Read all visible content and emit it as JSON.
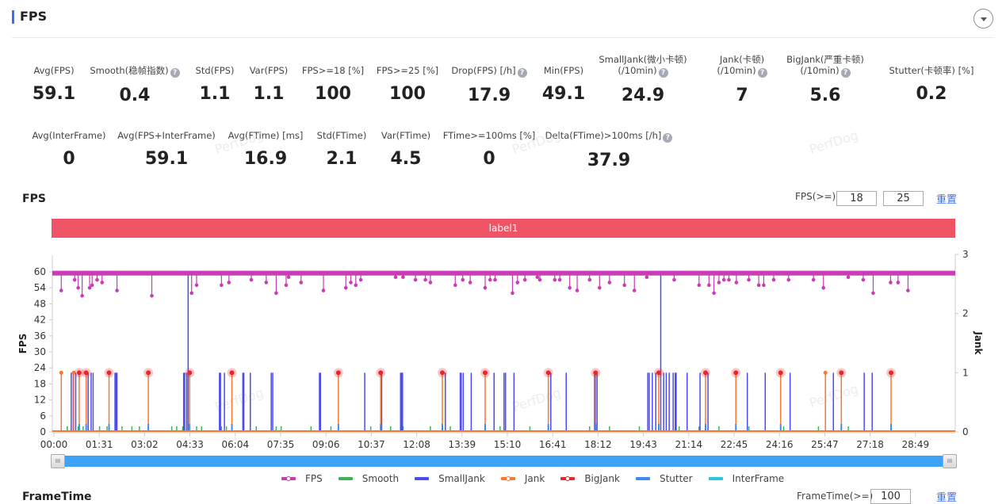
{
  "header": {
    "title": "FPS",
    "toggle_icon": "caret-down-icon"
  },
  "metrics_row1": [
    {
      "label": "Avg(FPS)",
      "value": "59.1",
      "help": false
    },
    {
      "label": "Smooth(稳帧指数)",
      "value": "0.4",
      "help": true
    },
    {
      "label": "Std(FPS)",
      "value": "1.1",
      "help": false
    },
    {
      "label": "Var(FPS)",
      "value": "1.1",
      "help": false
    },
    {
      "label": "FPS>=18 [%]",
      "value": "100",
      "help": false
    },
    {
      "label": "FPS>=25 [%]",
      "value": "100",
      "help": false
    },
    {
      "label": "Drop(FPS) [/h]",
      "value": "17.9",
      "help": true
    },
    {
      "label": "Min(FPS)",
      "value": "49.1",
      "help": false
    },
    {
      "label": "SmallJank(微小卡顿)",
      "label2": "(/10min)",
      "value": "24.9",
      "help": true
    },
    {
      "label": "Jank(卡顿)",
      "label2": "(/10min)",
      "value": "7",
      "help": true
    },
    {
      "label": "BigJank(严重卡顿)",
      "label2": "(/10min)",
      "value": "5.6",
      "help": true
    },
    {
      "label": "Stutter(卡顿率) [%]",
      "value": "0.2",
      "help": false
    }
  ],
  "metrics_row2": [
    {
      "label": "Avg(InterFrame)",
      "value": "0",
      "help": false
    },
    {
      "label": "Avg(FPS+InterFrame)",
      "value": "59.1",
      "help": false
    },
    {
      "label": "Avg(FTime) [ms]",
      "value": "16.9",
      "help": false
    },
    {
      "label": "Std(FTime)",
      "value": "2.1",
      "help": false
    },
    {
      "label": "Var(FTime)",
      "value": "4.5",
      "help": false
    },
    {
      "label": "FTime>=100ms [%]",
      "value": "0",
      "help": false
    },
    {
      "label": "Delta(FTime)>100ms [/h]",
      "value": "37.9",
      "help": true
    }
  ],
  "help_glyph": "?",
  "watermark": "PerfDog",
  "chart_section": {
    "title": "FPS",
    "filter_label": "FPS(>=)",
    "filter_values": [
      "18",
      "25"
    ],
    "reset_label": "重置",
    "label_bar": "label1",
    "slider_handle_glyph": "III"
  },
  "next_section": {
    "title": "FrameTime",
    "filter_label": "FrameTime(>=)",
    "filter_value": "100",
    "reset_label": "重置"
  },
  "colors": {
    "fps": "#c83cb4",
    "smooth": "#3cb45a",
    "smalljank": "#4b4bf0",
    "jank": "#fa7832",
    "bigjank": "#e6282d",
    "stutter": "#3c8cf0",
    "interframe": "#28c8dc",
    "label_bar": "#ee5465",
    "accent": "#3a6ff7"
  },
  "chart_data": {
    "type": "line",
    "title": "FPS",
    "ylabel": "FPS",
    "ylabel_right": "Jank",
    "ylim": [
      0,
      63
    ],
    "ylim_right": [
      0,
      3
    ],
    "yticks": [
      0,
      6,
      12,
      18,
      24,
      30,
      36,
      42,
      48,
      54,
      60
    ],
    "yticks_right": [
      0,
      1,
      2,
      3
    ],
    "xlabel": "",
    "x_range_seconds": [
      0,
      1815
    ],
    "xticks": [
      "00:00",
      "01:31",
      "03:02",
      "04:33",
      "06:04",
      "07:35",
      "09:06",
      "10:37",
      "12:08",
      "13:39",
      "15:10",
      "16:41",
      "18:12",
      "19:43",
      "21:14",
      "22:45",
      "24:16",
      "25:47",
      "27:18",
      "28:49"
    ],
    "legend": [
      "FPS",
      "Smooth",
      "SmallJank",
      "Jank",
      "BigJank",
      "Stutter",
      "InterFrame"
    ],
    "legend_position": "bottom",
    "fps_baseline": 59.5,
    "fps_dips": [
      [
        18,
        53
      ],
      [
        45,
        57
      ],
      [
        52,
        54
      ],
      [
        60,
        51
      ],
      [
        75,
        54
      ],
      [
        80,
        55
      ],
      [
        90,
        57
      ],
      [
        100,
        56
      ],
      [
        130,
        53
      ],
      [
        200,
        51
      ],
      [
        280,
        52
      ],
      [
        290,
        55
      ],
      [
        340,
        55
      ],
      [
        355,
        56
      ],
      [
        400,
        57
      ],
      [
        430,
        56
      ],
      [
        450,
        52
      ],
      [
        470,
        55
      ],
      [
        475,
        58
      ],
      [
        500,
        56
      ],
      [
        545,
        53
      ],
      [
        590,
        54
      ],
      [
        600,
        56
      ],
      [
        610,
        55
      ],
      [
        620,
        57
      ],
      [
        690,
        58
      ],
      [
        705,
        58
      ],
      [
        730,
        57
      ],
      [
        750,
        57
      ],
      [
        760,
        56
      ],
      [
        810,
        55
      ],
      [
        825,
        57
      ],
      [
        840,
        56
      ],
      [
        870,
        54
      ],
      [
        880,
        57
      ],
      [
        890,
        57
      ],
      [
        925,
        52
      ],
      [
        935,
        56
      ],
      [
        950,
        57
      ],
      [
        975,
        58
      ],
      [
        980,
        57
      ],
      [
        1010,
        57
      ],
      [
        1020,
        57
      ],
      [
        1040,
        54
      ],
      [
        1055,
        53
      ],
      [
        1080,
        57
      ],
      [
        1100,
        54
      ],
      [
        1120,
        56
      ],
      [
        1150,
        55
      ],
      [
        1170,
        53
      ],
      [
        1195,
        58
      ],
      [
        1250,
        57
      ],
      [
        1300,
        55
      ],
      [
        1320,
        55
      ],
      [
        1330,
        52
      ],
      [
        1340,
        56
      ],
      [
        1350,
        57
      ],
      [
        1360,
        57
      ],
      [
        1375,
        56
      ],
      [
        1400,
        57
      ],
      [
        1420,
        55
      ],
      [
        1430,
        55
      ],
      [
        1450,
        57
      ],
      [
        1480,
        57
      ],
      [
        1530,
        57
      ],
      [
        1550,
        54
      ],
      [
        1600,
        58
      ],
      [
        1630,
        57
      ],
      [
        1650,
        52
      ],
      [
        1685,
        56
      ],
      [
        1700,
        56
      ],
      [
        1720,
        53
      ]
    ],
    "bigjank_x": [
      54,
      68,
      114,
      193,
      276,
      361,
      575,
      660,
      784,
      870,
      997,
      1092,
      1219,
      1313,
      1374,
      1464,
      1586,
      1686
    ],
    "jank_only_x": [
      18,
      43,
      1554
    ],
    "smalljank": [
      [
        38,
        1
      ],
      [
        42,
        1
      ],
      [
        47,
        1
      ],
      [
        72,
        1
      ],
      [
        78,
        1
      ],
      [
        82,
        1
      ],
      [
        126,
        1
      ],
      [
        128,
        1
      ],
      [
        130,
        1
      ],
      [
        264,
        1
      ],
      [
        266,
        1
      ],
      [
        270,
        1
      ],
      [
        273,
        2.7
      ],
      [
        336,
        1
      ],
      [
        338,
        1
      ],
      [
        346,
        1
      ],
      [
        383,
        1
      ],
      [
        385,
        1
      ],
      [
        398,
        1
      ],
      [
        440,
        1
      ],
      [
        443,
        1
      ],
      [
        537,
        1
      ],
      [
        539,
        1
      ],
      [
        628,
        1
      ],
      [
        662,
        1
      ],
      [
        700,
        1
      ],
      [
        702,
        1
      ],
      [
        704,
        1
      ],
      [
        790,
        1
      ],
      [
        820,
        1
      ],
      [
        822,
        1
      ],
      [
        826,
        1
      ],
      [
        842,
        1
      ],
      [
        888,
        1
      ],
      [
        908,
        1
      ],
      [
        911,
        1
      ],
      [
        928,
        1
      ],
      [
        1002,
        1
      ],
      [
        1033,
        1
      ],
      [
        1090,
        1
      ],
      [
        1095,
        1
      ],
      [
        1197,
        1
      ],
      [
        1200,
        1
      ],
      [
        1206,
        1
      ],
      [
        1213,
        1
      ],
      [
        1223,
        2.7
      ],
      [
        1229,
        1
      ],
      [
        1234,
        1
      ],
      [
        1240,
        1
      ],
      [
        1248,
        1
      ],
      [
        1252,
        1
      ],
      [
        1254,
        1
      ],
      [
        1276,
        1
      ],
      [
        1302,
        1
      ],
      [
        1318,
        1
      ],
      [
        1397,
        1
      ],
      [
        1433,
        1
      ],
      [
        1483,
        1
      ],
      [
        1570,
        1
      ],
      [
        1632,
        1
      ],
      [
        1648,
        1
      ]
    ]
  }
}
